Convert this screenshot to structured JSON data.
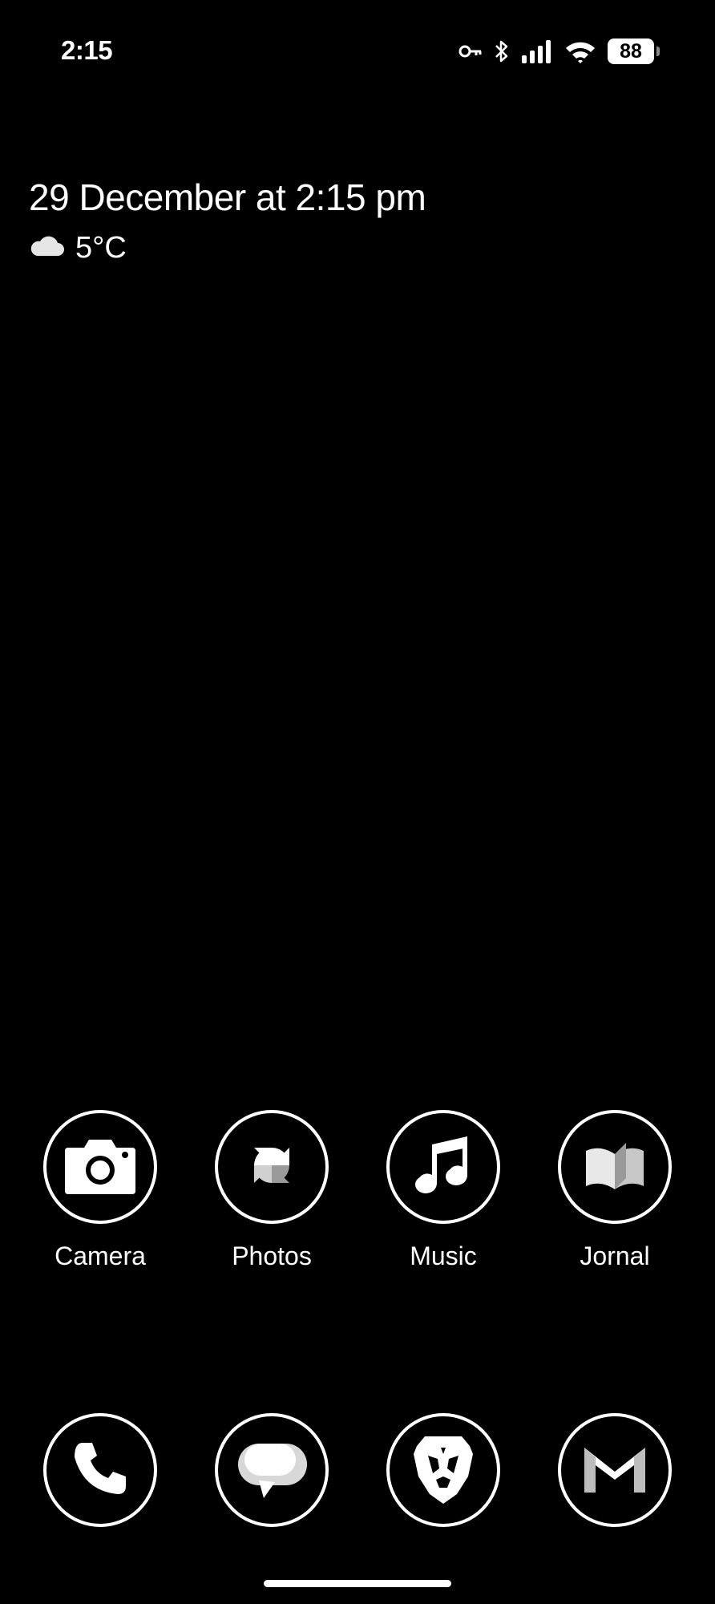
{
  "status_bar": {
    "time": "2:15",
    "battery_level": "88",
    "icons": [
      "vpn-key-icon",
      "bluetooth-icon",
      "cellular-signal-icon",
      "wifi-icon",
      "battery-icon"
    ]
  },
  "widget": {
    "date_text": "29 December at 2:15 pm",
    "temperature": "5°C",
    "weather_icon": "cloud-icon"
  },
  "apps": {
    "row1": [
      {
        "label": "Camera",
        "icon": "camera-icon"
      },
      {
        "label": "Photos",
        "icon": "pinwheel-photos-icon"
      },
      {
        "label": "Music",
        "icon": "music-note-icon"
      },
      {
        "label": "Jornal",
        "icon": "open-book-icon"
      }
    ],
    "dock": [
      {
        "icon": "phone-icon"
      },
      {
        "icon": "messages-bubble-icon"
      },
      {
        "icon": "brave-lion-icon"
      },
      {
        "icon": "gmail-icon"
      }
    ]
  },
  "colors": {
    "background": "#000000",
    "foreground": "#ffffff"
  }
}
